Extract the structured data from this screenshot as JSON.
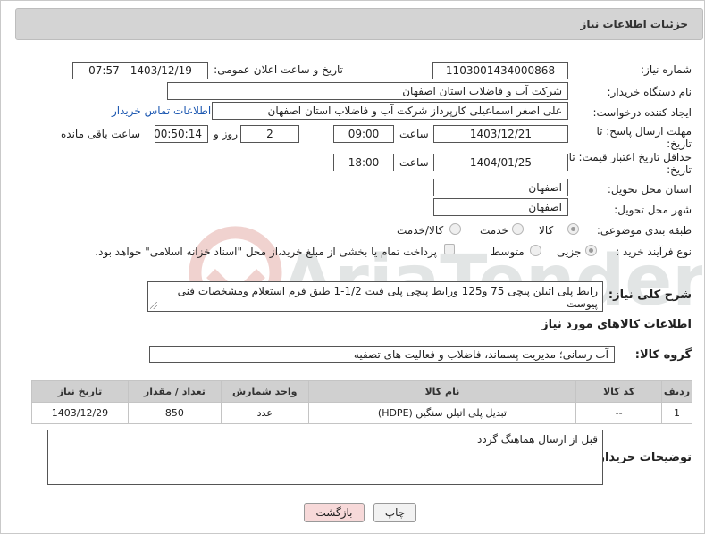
{
  "page": {
    "title": "جزئیات اطلاعات نیاز"
  },
  "form": {
    "need_number_label": "شماره نیاز:",
    "need_number": "1103001434000868",
    "announce_label": "تاریخ و ساعت اعلان عمومی:",
    "announce_value": "1403/12/19 - 07:57",
    "buyer_label": "نام دستگاه خریدار:",
    "buyer_value": "شرکت آب و فاضلاب استان اصفهان",
    "creator_label": "ایجاد کننده درخواست:",
    "creator_value": "علی اصغر اسماعیلی کارپرداز شرکت آب و فاضلاب استان اصفهان",
    "contact_link": "اطلاعات تماس خریدار",
    "deadline_label_1": "مهلت ارسال پاسخ: تا",
    "deadline_label_2": "تاریخ:",
    "deadline_date": "1403/12/21",
    "time_label": "ساعت",
    "deadline_time": "09:00",
    "days_value": "2",
    "days_label": "روز و",
    "remaining_value": "00:50:14",
    "remaining_label": "ساعت باقی مانده",
    "validity_label_1": "حداقل تاریخ اعتبار قیمت: تا",
    "validity_label_2": "تاریخ:",
    "validity_date": "1404/01/25",
    "validity_time": "18:00",
    "province_label": "استان محل تحویل:",
    "province_value": "اصفهان",
    "city_label": "شهر محل تحویل:",
    "city_value": "اصفهان",
    "category_label": "طبقه بندی موضوعی:",
    "category_options": [
      "کالا",
      "خدمت",
      "کالا/خدمت"
    ],
    "process_label": "نوع فرآیند خرید :",
    "process_options": [
      "جزیی",
      "متوسط"
    ],
    "payment_text": "پرداخت تمام یا بخشی از مبلغ خرید،از محل \"اسناد خزانه اسلامی\" خواهد بود.",
    "description_label": "شرح کلی نیاز:",
    "description_value": "رابط پلی اتیلن پیچی 75 و125 ورابط پیچی پلی فیت 1/2-1 طبق فرم استعلام ومشخصات فنی پیوست",
    "goods_info_title": "اطلاعات کالاهای مورد نیاز",
    "goods_group_label": "گروه کالا:",
    "goods_group_value": "آب رسانی؛ مدیریت پسماند، فاضلاب و فعالیت های تصفیه",
    "buyer_notes_label": "توضیحات خریدار:",
    "buyer_notes_value": "قبل از ارسال هماهنگ گردد"
  },
  "table": {
    "headers": [
      "ردیف",
      "کد کالا",
      "نام کالا",
      "واحد شمارش",
      "تعداد / مقدار",
      "تاریخ نیاز"
    ],
    "rows": [
      [
        "1",
        "--",
        "تبدیل پلی اتیلن سنگین (HDPE)",
        "عدد",
        "850",
        "1403/12/29"
      ]
    ]
  },
  "buttons": {
    "print": "چاپ",
    "back": "بازگشت"
  },
  "watermark_text": "AriaTender.neT",
  "colors": {
    "link": "#1a56b0",
    "header_bg": "#d4d4d4",
    "back_button_bg": "#f7d9d9",
    "print_button_bg": "#f2f2f2"
  }
}
